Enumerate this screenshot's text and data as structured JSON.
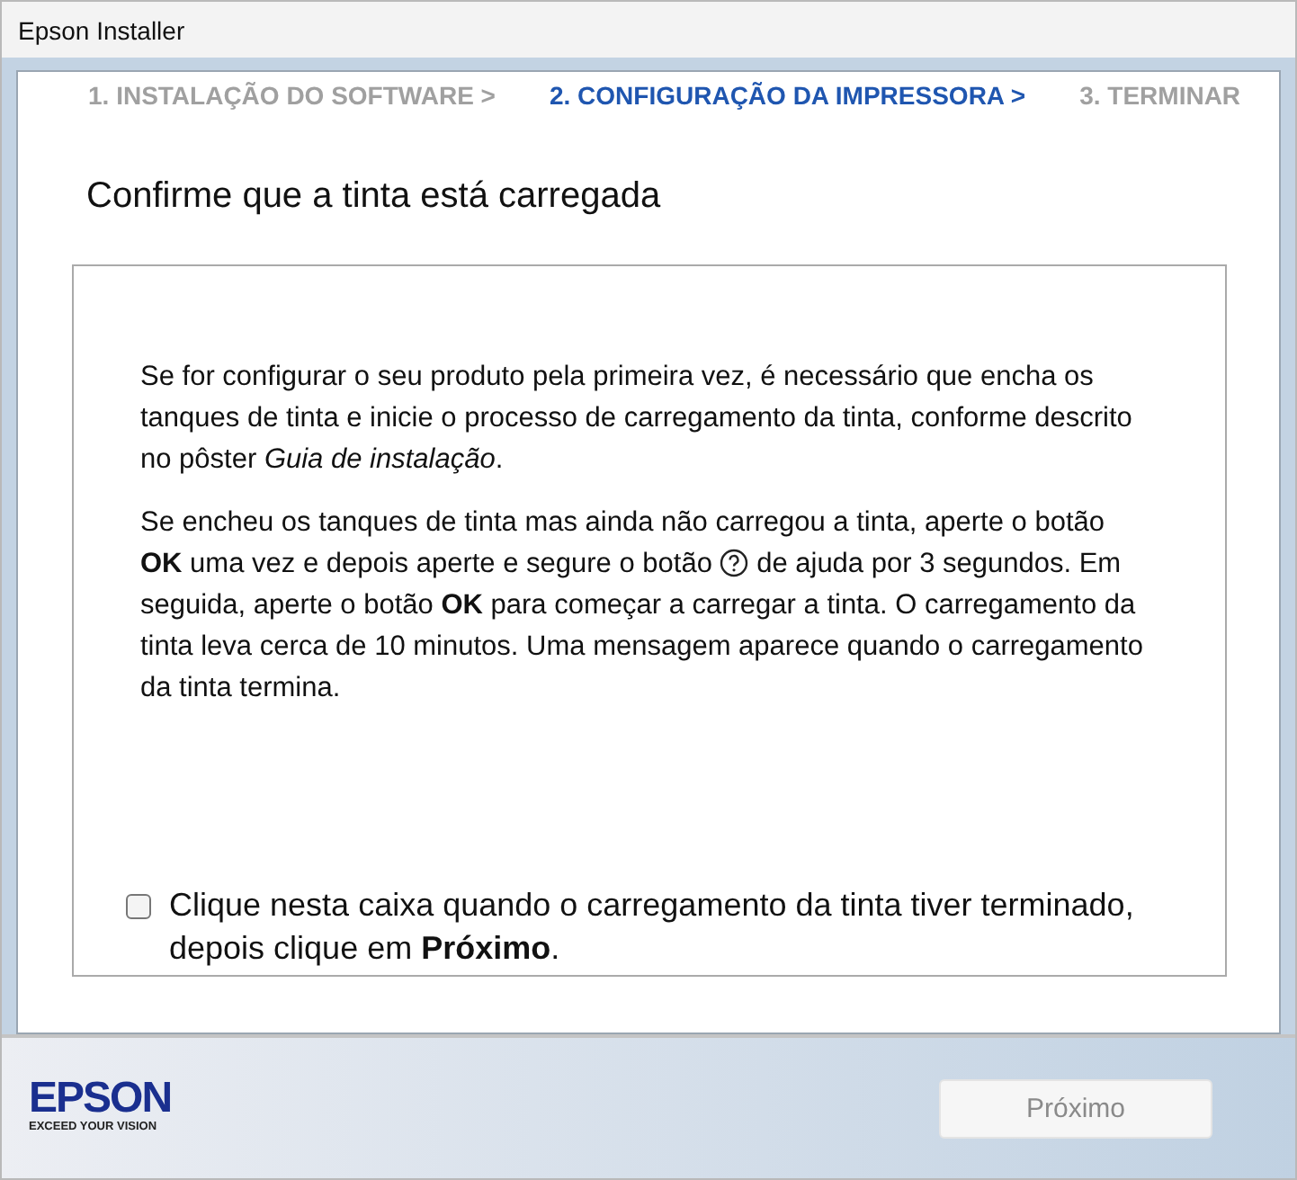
{
  "window": {
    "title": "Epson Installer"
  },
  "steps": [
    {
      "label": "1. INSTALAÇÃO DO SOFTWARE >",
      "selected": false
    },
    {
      "label": "2. CONFIGURAÇÃO DA IMPRESSORA >",
      "selected": true
    },
    {
      "label": "3. TERMINAR",
      "selected": false
    }
  ],
  "heading": "Confirme que a tinta está carregada",
  "paragraphs": [
    {
      "text": "Se for configurar o seu produto pela primeira vez, é necessário que encha os tanques de tinta e inicie o processo de carregamento da tinta, conforme descrito no pôster *Guia de instalação*."
    },
    {
      "text": "Se encheu os tanques de tinta mas ainda não carregou a tinta, aperte o botão **OK** uma vez e depois aperte e segure o botão",
      "after": "de ajuda por 3 segundos. Em seguida, aperte o botão **OK** para começar a carregar a tinta. O carregamento da tinta leva cerca de 10 minutos. Uma mensagem aparece quando o carregamento da tinta termina."
    }
  ],
  "confirm": {
    "label": "Clique nesta caixa quando o carregamento da tinta tiver terminado, depois clique em **Próximo**.",
    "checked": false
  },
  "logo": {
    "name": "EPSON",
    "tagline": "EXCEED YOUR VISION"
  },
  "next_button": {
    "label": "Próximo",
    "disabled": true
  }
}
